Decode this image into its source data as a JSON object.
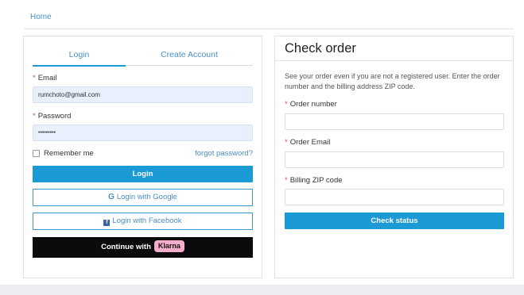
{
  "breadcrumb": {
    "home": "Home"
  },
  "login": {
    "tabs": [
      {
        "label": "Login",
        "active": true
      },
      {
        "label": "Create Account",
        "active": false
      }
    ],
    "email_label": "Email",
    "email_value": "rumchoto@gmail.com",
    "password_label": "Password",
    "password_value": "•••••••••",
    "required_mark": "*",
    "remember_label": "Remember me",
    "forgot_label": "forgot password?",
    "login_button": "Login",
    "google_button": "Login with Google",
    "google_icon": "G",
    "facebook_button": "Login with Facebook",
    "facebook_icon": "f",
    "klarna_button": "Continue with",
    "klarna_badge": "Klarna"
  },
  "check_order": {
    "title": "Check order",
    "description": "See your order even if you are not a registered user. Enter the order number and the billing address ZIP code.",
    "order_number_label": "Order number",
    "order_email_label": "Order Email",
    "billing_zip_label": "Billing ZIP code",
    "button": "Check status"
  },
  "colors": {
    "accent": "#1c9ad6",
    "link": "#4a8fc7",
    "required": "#d9534f",
    "klarna_bg": "#0b0b0b",
    "klarna_badge": "#f4aecb"
  }
}
